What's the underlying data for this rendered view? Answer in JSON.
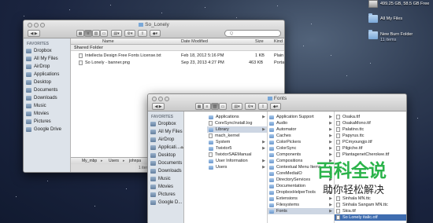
{
  "desktop": {
    "items": [
      {
        "label": "499.25 GB, 58.5 GB Free",
        "icon": "hard-drive-icon"
      },
      {
        "label": "All My Files",
        "icon": "folder-icon"
      },
      {
        "label": "New Burn Folder",
        "sub": "11 items",
        "icon": "burn-folder-icon"
      }
    ]
  },
  "back_window": {
    "title": "So_Lonely",
    "toolbar": {
      "search_placeholder": "Q"
    },
    "sidebar": {
      "heading": "FAVORITES",
      "items": [
        "Dropbox",
        "All My Files",
        "AirDrop",
        "Applications",
        "Desktop",
        "Documents",
        "Downloads",
        "Music",
        "Movies",
        "Pictures",
        "Google Drive"
      ]
    },
    "columns": {
      "name": "Name",
      "date": "Date Modified",
      "size": "Size",
      "kind": "Kind"
    },
    "group": "Shared Folder",
    "files": [
      {
        "name": "Intellecta Design Free Fonts License.txt",
        "date": "Feb 18, 2012 5:16 PM",
        "size": "1 KB",
        "kind": "Plain"
      },
      {
        "name": "So Lonely - banner.png",
        "date": "Sep 23, 2013 4:27 PM",
        "size": "463 KB",
        "kind": "Porta"
      }
    ],
    "pathbar": [
      "My_mbp",
      "Users",
      "johnpa"
    ],
    "status": "1 items"
  },
  "front_window": {
    "title": "Fonts",
    "sidebar": {
      "heading": "FAVORITES",
      "items": [
        "Dropbox",
        "All My Files",
        "AirDrop",
        "Applicati...",
        "Desktop",
        "Documents",
        "Downloads",
        "Music",
        "Movies",
        "Pictures",
        "Google D..."
      ]
    },
    "column1": [
      "Applications",
      "CoreSyncInstall.log",
      "Library",
      "mach_kernel",
      "System",
      "Twixtor5",
      "TwixtorSAEManual",
      "User Information",
      "Users"
    ],
    "column2": [
      "Application Support",
      "Audio",
      "Automator",
      "Caches",
      "ColorPickers",
      "ColorSync",
      "Components",
      "Compositions",
      "Contextual Menu Items",
      "CoreMediaIO",
      "DirectoryServices",
      "Documentation",
      "DropboxHelperTools",
      "Extensions",
      "Filesystems",
      "Fonts"
    ],
    "column3": [
      "Osaka.ttf",
      "OsakaMono.ttf",
      "Palatino.ttc",
      "Papyrus.ttc",
      "PCmyoungjo.ttf",
      "Pilgiche.ttf",
      "PlantagenetCherokee.ttf",
      "",
      "",
      "",
      "",
      "",
      "",
      "Sinhala MN.ttc",
      "Sinhala Sangam MN.ttc",
      "Skia.ttf",
      "So Lonely italic.otf"
    ]
  },
  "watermark": {
    "big": "百科全说",
    "small": "助你轻松解决"
  },
  "colors": {
    "selection": "#3f6db0",
    "sidebar": "#dde3ea",
    "watermark": "#2bb34a"
  }
}
